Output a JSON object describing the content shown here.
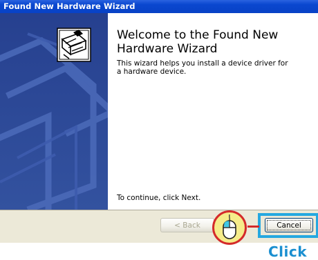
{
  "window": {
    "title": "Found New Hardware Wizard"
  },
  "content": {
    "heading": "Welcome to the Found New Hardware Wizard",
    "description": "This wizard helps you install a device driver for a hardware device.",
    "continue_hint": "To continue, click Next."
  },
  "buttons": {
    "back": "< Back",
    "cancel": "Cancel"
  },
  "annotation": {
    "click_label": "Click"
  },
  "icons": [
    "hardware-wizard-icon",
    "mouse-icon"
  ],
  "colors": {
    "titlebar": "#0a47cf",
    "sidebar": "#2d4a9c",
    "footer": "#ece9d8",
    "highlight": "#25a8e0",
    "mouse_circle_border": "#d42a2a",
    "click_label": "#1a8fd0"
  }
}
